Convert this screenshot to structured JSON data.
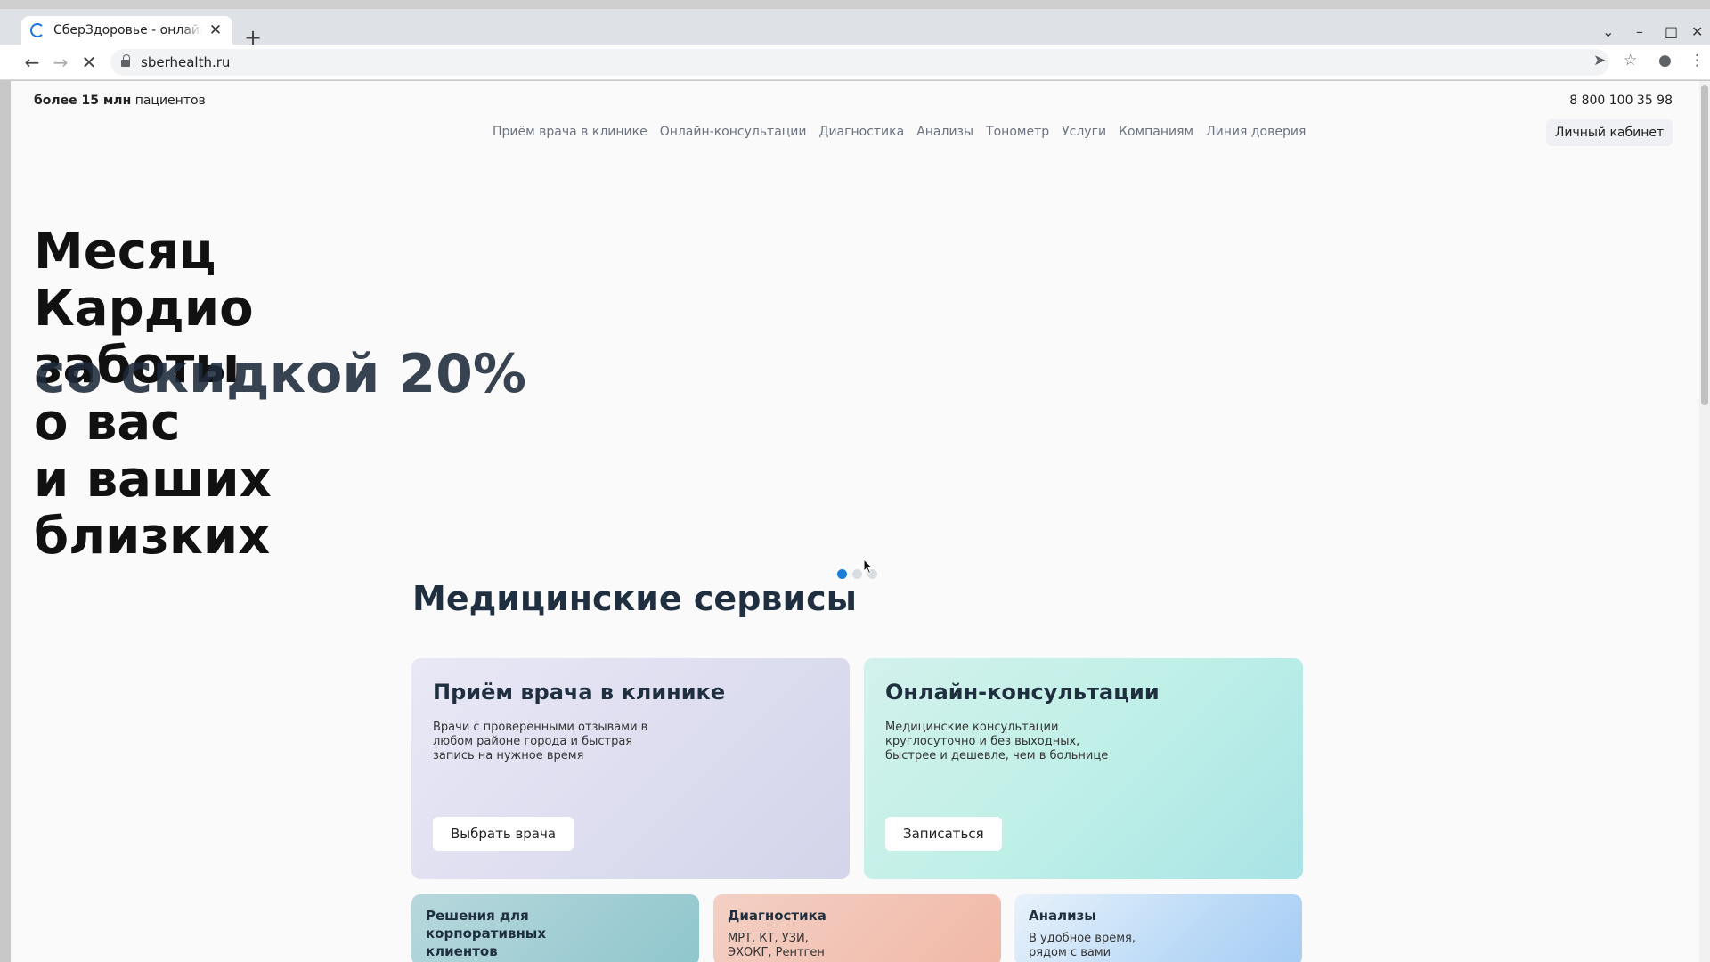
{
  "browser": {
    "tab_title": "СберЗдоровье - онлайн к",
    "tab_close": "✕",
    "new_tab": "+",
    "url": "sberhealth.ru",
    "icons": [
      "back-icon",
      "forward-icon",
      "stop-icon",
      "lock-icon",
      "send-icon",
      "star-icon",
      "profile-icon",
      "menu-icon"
    ]
  },
  "header": {
    "patients_bold": "более 15 млн",
    "patients_rest": " пациентов",
    "phone": "8 800 100 35 98",
    "cabinet_label": "Личный кабинет",
    "nav": [
      {
        "label": "Приём врача в клинике"
      },
      {
        "label": "Онлайн-консультации"
      },
      {
        "label": "Диагностика"
      },
      {
        "label": "Анализы"
      },
      {
        "label": "Тонометр"
      },
      {
        "label": "Услуги"
      },
      {
        "label": "Компаниям"
      },
      {
        "label": "Линия доверия"
      }
    ]
  },
  "hero": {
    "lines": [
      "Месяц",
      "Кардио",
      "заботы",
      "о вас",
      "и ваших",
      "близких"
    ],
    "overlay": "со скидкой 20%",
    "slides_total": 3,
    "slide_active": 1
  },
  "services": {
    "title": "Медицинские сервисы",
    "doctor": {
      "title": "Приём врача в клинике",
      "text": "Врачи с проверенными отзывами в любом районе города и быстрая запись на нужное время",
      "button": "Выбрать врача"
    },
    "online": {
      "title": "Онлайн-консультации",
      "text": "Медицинские консультации круглосуточно и без выходных, быстрее и дешевле, чем в больнице",
      "button": "Записаться"
    },
    "corporate": {
      "title": "Решения для корпоративных клиентов"
    },
    "diagnostics": {
      "title": "Диагностика",
      "text": "МРТ, КТ, УЗИ, ЭХОКГ, Рентген"
    },
    "tests": {
      "title": "Анализы",
      "text": "В удобное время, рядом с вами"
    }
  },
  "colors": {
    "accent": "#1a7ed8",
    "heading": "#1f2f3f"
  }
}
